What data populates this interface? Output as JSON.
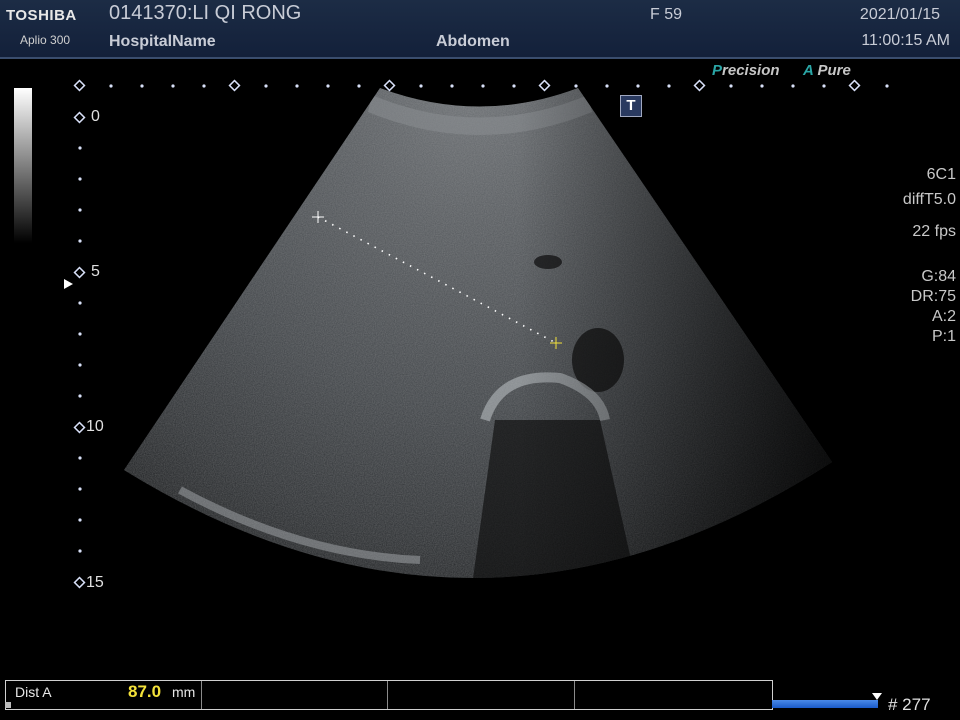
{
  "header": {
    "brand": "TOSHIBA",
    "model": "Aplio 300",
    "patient": "0141370:LI QI RONG",
    "hospital": "HospitalName",
    "preset": "Abdomen",
    "frame_rate_label": "F  59",
    "date": "2021/01/15",
    "time": "11:00:15 AM"
  },
  "badges": {
    "precision_first": "P",
    "precision_rest": "recision",
    "apure_first": "A",
    "apure_rest": " Pure",
    "t_button": "T"
  },
  "params": {
    "probe": "6C1",
    "mode": "diffT5.0",
    "fps": "22 fps",
    "gain": "G:84",
    "dr": "DR:75",
    "a": "A:2",
    "p": "P:1"
  },
  "depth_scale": [
    "0",
    "5",
    "10",
    "15"
  ],
  "measurement": {
    "label": "Dist A",
    "value": "87.0",
    "unit": "mm"
  },
  "cine": {
    "frame": "# 277",
    "fill_fraction": 0.95
  },
  "colors": {
    "header_bg": "#1c2c45",
    "accent_teal": "#2aa6a6",
    "measure_yellow": "#f4e23a",
    "cine_blue": "#1a5ac8"
  }
}
